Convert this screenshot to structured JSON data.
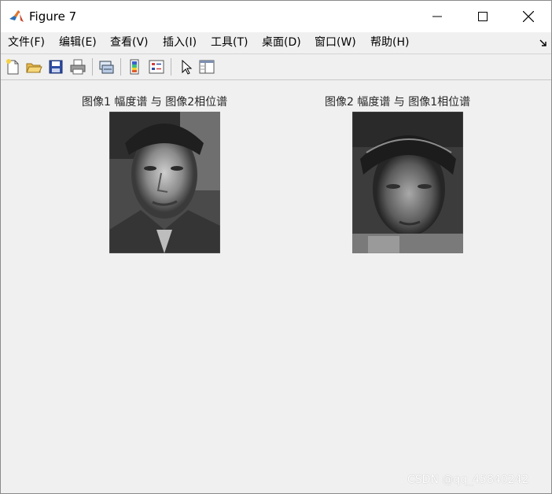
{
  "window": {
    "title": "Figure 7"
  },
  "menubar": {
    "items": [
      {
        "label": "文件(F)"
      },
      {
        "label": "编辑(E)"
      },
      {
        "label": "查看(V)"
      },
      {
        "label": "插入(I)"
      },
      {
        "label": "工具(T)"
      },
      {
        "label": "桌面(D)"
      },
      {
        "label": "窗口(W)"
      },
      {
        "label": "帮助(H)"
      }
    ]
  },
  "toolbar": {
    "icons": [
      "new-figure-icon",
      "open-file-icon",
      "save-icon",
      "print-icon",
      "link-plot-icon",
      "colorbar-icon",
      "legend-icon",
      "pointer-icon",
      "property-inspector-icon"
    ]
  },
  "figure": {
    "subplots": [
      {
        "title": "图像1 幅度谱 与 图像2相位谱"
      },
      {
        "title": "图像2 幅度谱 与 图像1相位谱"
      }
    ]
  },
  "watermark": "CSDN @qq_45840242",
  "colors": {
    "background": "#f0f0f0",
    "titlebar": "#ffffff",
    "text": "#262626"
  }
}
